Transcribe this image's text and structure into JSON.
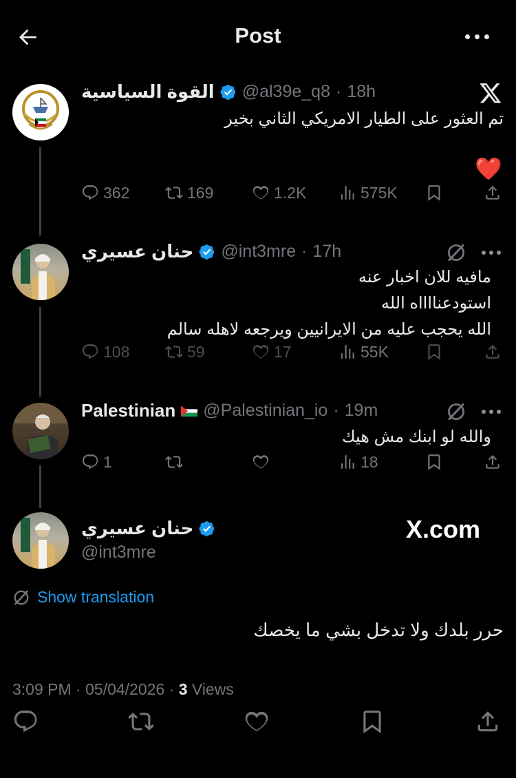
{
  "header": {
    "title": "Post"
  },
  "posts": [
    {
      "name": "القوة السياسية",
      "handle": "@al39e_q8",
      "time": "18h",
      "text": "تم العثور على الطيار الامريكي الثاني بخير",
      "emoji": "❤️",
      "stats": {
        "replies": "362",
        "reposts": "169",
        "likes": "1.2K",
        "views": "575K"
      }
    },
    {
      "name": "حنان عسيري",
      "handle": "@int3mre",
      "time": "17h",
      "lines": [
        "مافيه للان اخبار عنه",
        "استودعنااااه الله",
        "الله يحجب عليه من الايرانيين ويرجعه لاهله سالم"
      ],
      "stats": {
        "replies": "108",
        "reposts": "59",
        "likes": "17",
        "views": "55K"
      }
    },
    {
      "name": "Palestinian",
      "handle": "@Palestinian_io",
      "time": "19m",
      "text": "والله لو ابنك مش هيك",
      "stats": {
        "replies": "1",
        "views": "18"
      }
    }
  ],
  "main_post": {
    "name": "حنان عسيري",
    "handle": "@int3mre",
    "watermark": "X.com",
    "show_translation": "Show translation",
    "text": "حرر بلدك ولا تدخل بشي ما يخصك",
    "time": "3:09 PM",
    "date": "05/04/2026",
    "views_count": "3",
    "views_label": "Views"
  },
  "colors": {
    "background": "#000000",
    "text": "#e7e9ea",
    "secondary": "#71767b",
    "verified": "#1d9bf0",
    "link": "#1d9bf0"
  },
  "icons": [
    "back-arrow-icon",
    "more-icon",
    "x-logo-icon",
    "grok-icon",
    "verified-icon",
    "reply-icon",
    "repost-icon",
    "like-icon",
    "views-icon",
    "bookmark-icon",
    "share-icon",
    "palestine-flag-icon",
    "translate-icon"
  ]
}
